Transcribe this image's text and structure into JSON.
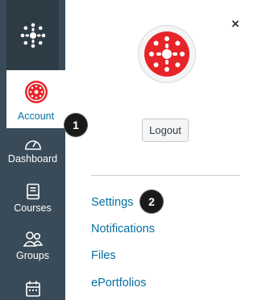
{
  "nav": {
    "account_label": "Account",
    "dashboard_label": "Dashboard",
    "courses_label": "Courses",
    "groups_label": "Groups"
  },
  "tray": {
    "close_glyph": "×",
    "logout_label": "Logout",
    "links": [
      "Settings",
      "Notifications",
      "Files",
      "ePortfolios"
    ]
  },
  "callouts": [
    "1",
    "2"
  ],
  "colors": {
    "nav_bg": "#394b58",
    "logo_bg": "#2d3b45",
    "brand_red": "#e72429",
    "link_blue": "#0770a3"
  },
  "icons": [
    "canvas-logo-icon",
    "account-avatar-icon",
    "dashboard-icon",
    "courses-icon",
    "groups-icon",
    "calendar-icon",
    "close-icon"
  ]
}
